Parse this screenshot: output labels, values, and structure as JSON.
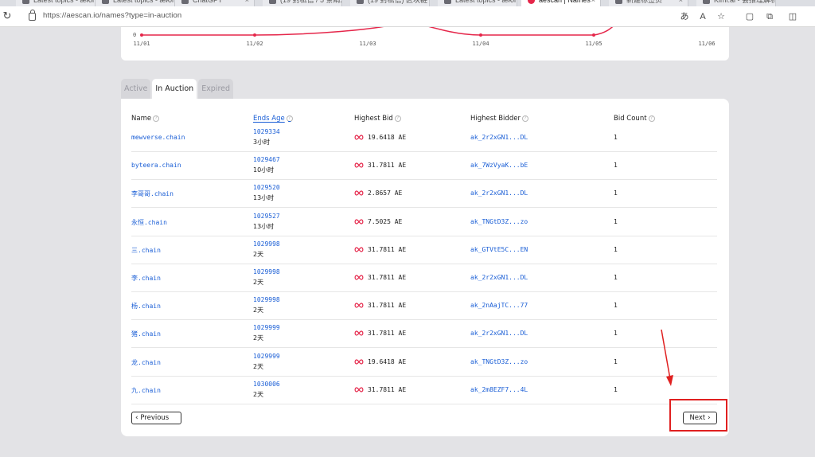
{
  "browser": {
    "tabs": [
      {
        "title": "Latest topics - æforum",
        "active": false
      },
      {
        "title": "Latest topics - æforum",
        "active": false
      },
      {
        "title": "ChatGPT",
        "active": false
      },
      {
        "title": "(19 封私信 / 5 条消息)",
        "active": false
      },
      {
        "title": "(19 封私信) 区块链",
        "active": false
      },
      {
        "title": "Latest topics - æforum",
        "active": false
      },
      {
        "title": "aescan | Names",
        "active": true
      },
      {
        "title": "新建标签页",
        "active": false
      },
      {
        "title": "Kimi.ai - 会推理解析",
        "active": false
      }
    ],
    "url": "https://aescan.io/names?type=in-auction",
    "icons": [
      "reload-icon",
      "lock-icon",
      "translate-icon",
      "read-aloud-icon",
      "favorites-icon",
      "collections-icon",
      "split-screen-icon"
    ]
  },
  "chart": {
    "y_label": "0",
    "x_ticks": [
      "11/01",
      "11/02",
      "11/03",
      "11/04",
      "11/05",
      "11/06"
    ],
    "line_color": "#e5264a"
  },
  "chart_data": {
    "type": "line",
    "categories": [
      "11/01",
      "11/02",
      "11/03",
      "11/04",
      "11/05",
      "11/06"
    ],
    "series": [
      {
        "values": [
          0,
          0,
          null,
          0,
          0,
          null
        ]
      }
    ],
    "xlabel": "",
    "ylabel": ""
  },
  "page_tabs": [
    {
      "label": "Active",
      "active": false
    },
    {
      "label": "In Auction",
      "active": true
    },
    {
      "label": "Expired",
      "active": false
    }
  ],
  "table": {
    "headers": {
      "name": "Name",
      "ends_age": "Ends Age",
      "highest_bid": "Highest Bid",
      "highest_bidder": "Highest Bidder",
      "bid_count": "Bid Count"
    },
    "rows": [
      {
        "name": "mewverse.chain",
        "block": "1029334",
        "age": "3小时",
        "bid": "19.6418 AE",
        "bidder": "ak_2r2xGN1...DL",
        "count": "1"
      },
      {
        "name": "byteera.chain",
        "block": "1029467",
        "age": "10小时",
        "bid": "31.7811 AE",
        "bidder": "ak_7WzVyaK...bE",
        "count": "1"
      },
      {
        "name": "李哥哥.chain",
        "block": "1029520",
        "age": "13小时",
        "bid": "2.8657 AE",
        "bidder": "ak_2r2xGN1...DL",
        "count": "1"
      },
      {
        "name": "永恒.chain",
        "block": "1029527",
        "age": "13小时",
        "bid": "7.5025 AE",
        "bidder": "ak_TNGtD3Z...zo",
        "count": "1"
      },
      {
        "name": "三.chain",
        "block": "1029998",
        "age": "2天",
        "bid": "31.7811 AE",
        "bidder": "ak_GTVtE5C...EN",
        "count": "1"
      },
      {
        "name": "李.chain",
        "block": "1029998",
        "age": "2天",
        "bid": "31.7811 AE",
        "bidder": "ak_2r2xGN1...DL",
        "count": "1"
      },
      {
        "name": "杨.chain",
        "block": "1029998",
        "age": "2天",
        "bid": "31.7811 AE",
        "bidder": "ak_2nAajTC...77",
        "count": "1"
      },
      {
        "name": "猪.chain",
        "block": "1029999",
        "age": "2天",
        "bid": "31.7811 AE",
        "bidder": "ak_2r2xGN1...DL",
        "count": "1"
      },
      {
        "name": "龙.chain",
        "block": "1029999",
        "age": "2天",
        "bid": "19.6418 AE",
        "bidder": "ak_TNGtD3Z...zo",
        "count": "1"
      },
      {
        "name": "九.chain",
        "block": "1030006",
        "age": "2天",
        "bid": "31.7811 AE",
        "bidder": "ak_2m8EZF7...4L",
        "count": "1"
      }
    ]
  },
  "pagination": {
    "previous_label": "Previous",
    "next_label": "Next"
  },
  "annotation_color": "#e02020"
}
